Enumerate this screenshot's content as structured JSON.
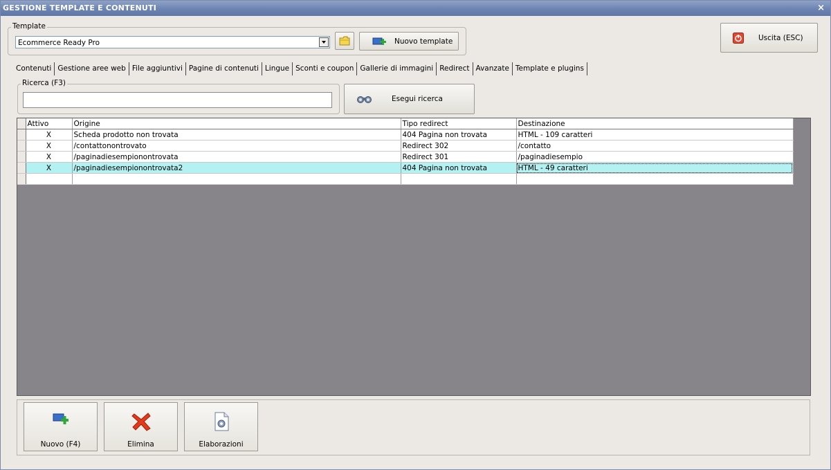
{
  "window": {
    "title": "GESTIONE TEMPLATE E CONTENUTI",
    "close_glyph": "×"
  },
  "template_group": {
    "label": "Template",
    "selected": "Ecommerce Ready Pro",
    "folder_icon": "folder-icon",
    "new_template_label": "Nuovo template"
  },
  "exit_button": {
    "label": "Uscita (ESC)",
    "icon": "power-icon"
  },
  "tabs": [
    {
      "label": "Contenuti"
    },
    {
      "label": "Gestione aree web"
    },
    {
      "label": "File aggiuntivi"
    },
    {
      "label": "Pagine di contenuti"
    },
    {
      "label": "Lingue"
    },
    {
      "label": "Sconti e coupon"
    },
    {
      "label": "Gallerie di immagini"
    },
    {
      "label": "Redirect"
    },
    {
      "label": "Avanzate"
    },
    {
      "label": "Template e plugins"
    }
  ],
  "active_tab": "Redirect",
  "search": {
    "label": "Ricerca (F3)",
    "value": "",
    "button_label": "Esegui ricerca",
    "icon": "binoculars-icon"
  },
  "grid": {
    "columns": [
      "Attivo",
      "Origine",
      "Tipo redirect",
      "Destinazione"
    ],
    "rows": [
      {
        "attivo": "X",
        "origine": "Scheda prodotto non trovata",
        "tipo": "404 Pagina non trovata",
        "destinazione": "HTML - 109 caratteri"
      },
      {
        "attivo": "X",
        "origine": "/contattonontrovato",
        "tipo": "Redirect 302",
        "destinazione": "/contatto"
      },
      {
        "attivo": "X",
        "origine": "/paginadiesempionontrovata",
        "tipo": "Redirect 301",
        "destinazione": "/paginadiesempio"
      },
      {
        "attivo": "X",
        "origine": "/paginadiesempionontrovata2",
        "tipo": "404 Pagina non trovata",
        "destinazione": "HTML - 49 caratteri"
      },
      {
        "attivo": "",
        "origine": "",
        "tipo": "",
        "destinazione": ""
      }
    ],
    "highlighted_row": 3,
    "highlight_color": "#b3f1f3"
  },
  "actions": [
    {
      "label": "Nuovo (F4)",
      "icon": "add-icon"
    },
    {
      "label": "Elimina",
      "icon": "delete-x-icon"
    },
    {
      "label": "Elaborazioni",
      "icon": "document-gear-icon"
    }
  ]
}
